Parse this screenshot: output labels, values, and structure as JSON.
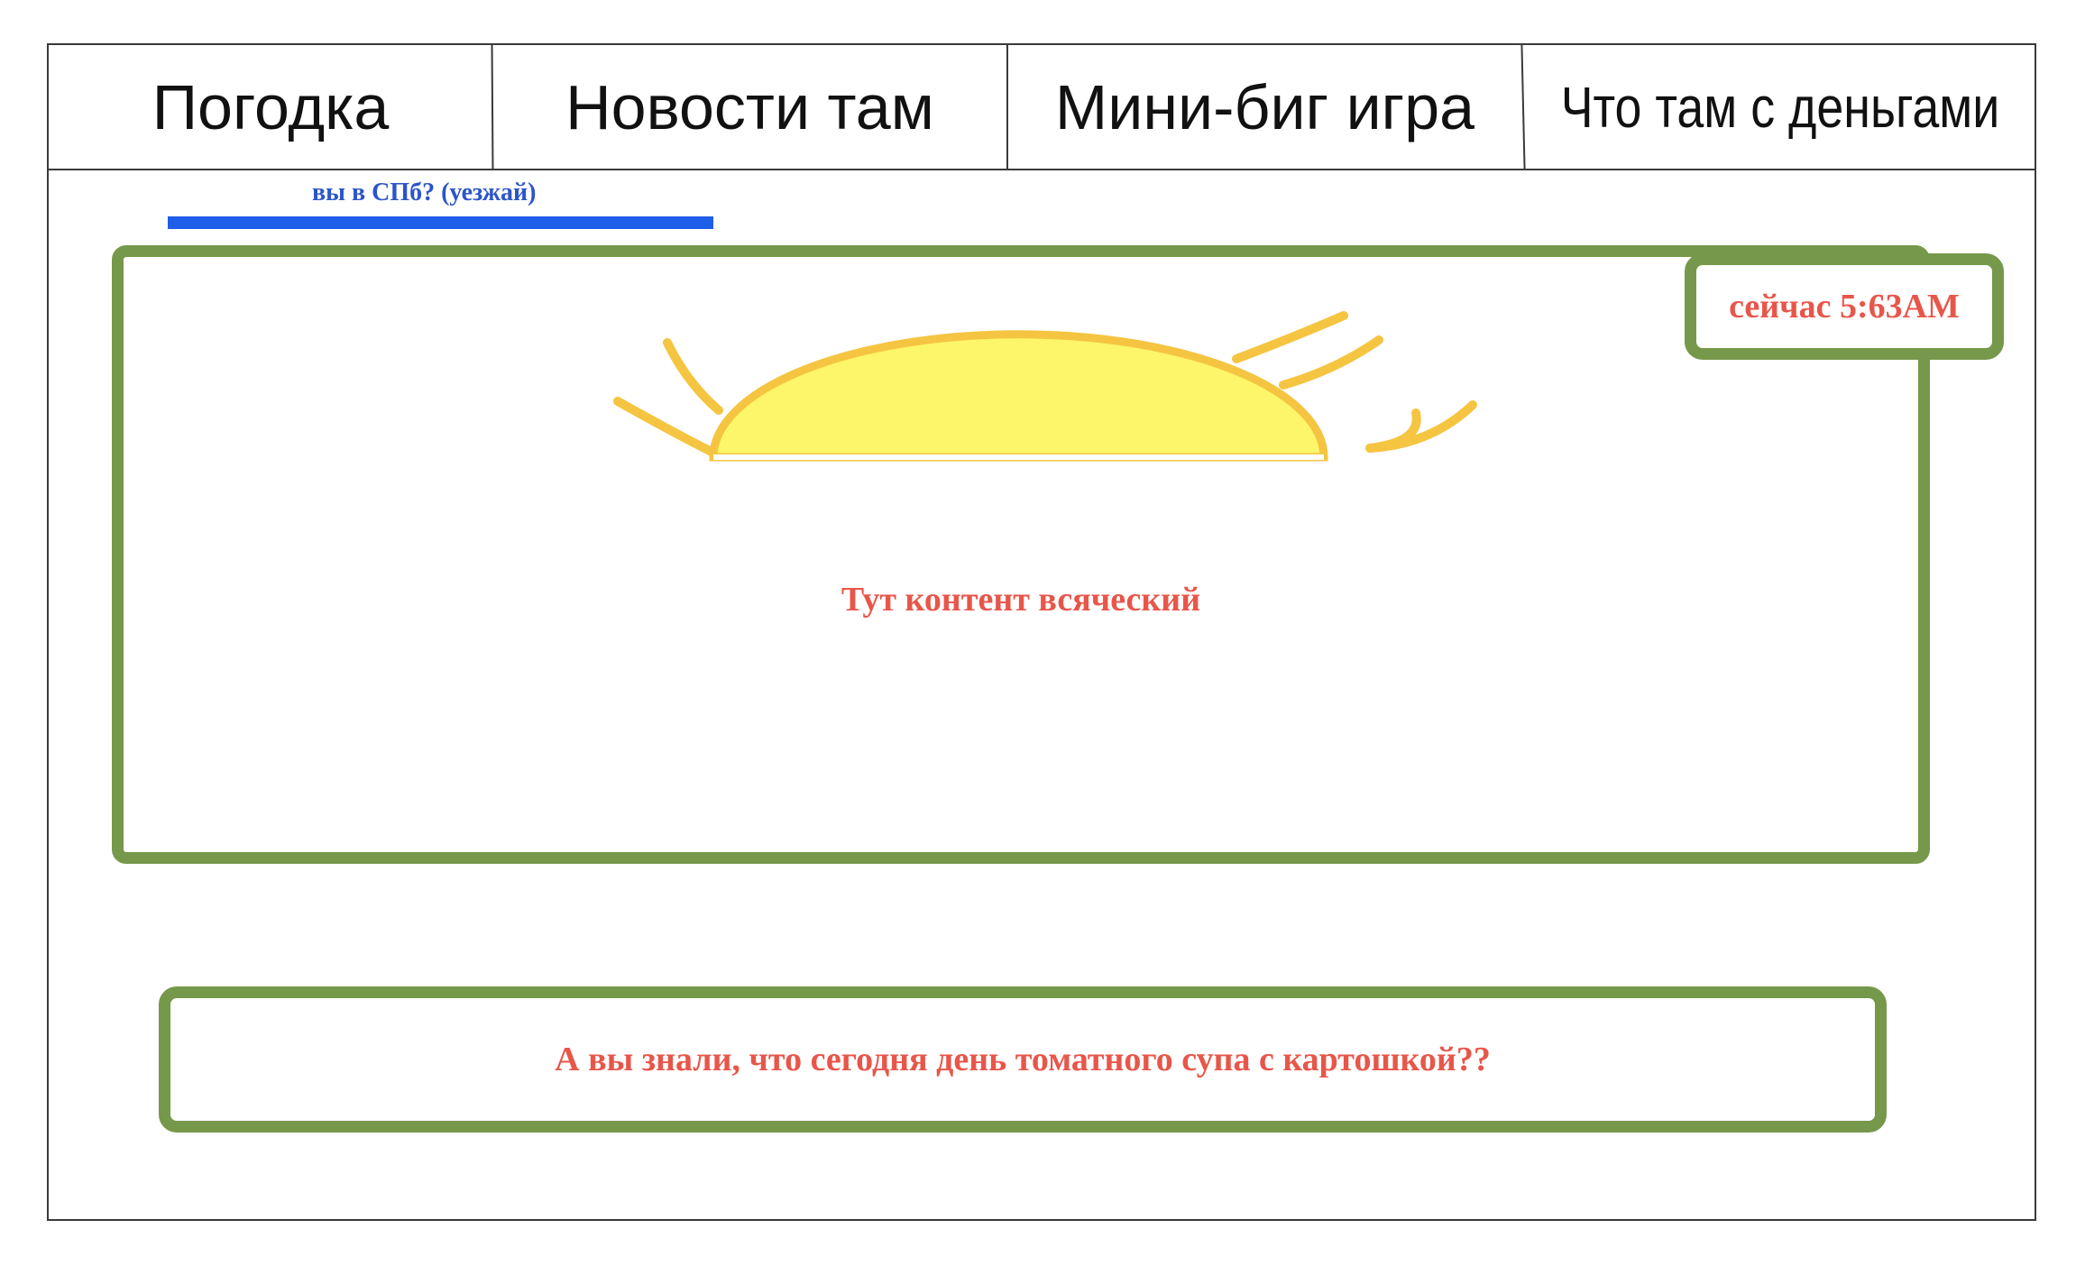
{
  "nav": {
    "tabs": [
      {
        "label": "Погодка"
      },
      {
        "label": "Новости там"
      },
      {
        "label": "Мини-биг игра"
      },
      {
        "label": "Что там с деньгами"
      }
    ]
  },
  "location_prompt": "вы в СПб? (уезжай)",
  "weather": {
    "icon": "sun-icon",
    "time_label": "сейчас 5:63AM",
    "content_placeholder": "Тут контент всяческий"
  },
  "fact": {
    "text": "А вы знали, что сегодня день томатного супа с картошкой??"
  },
  "colors": {
    "panel_border": "#76984a",
    "accent_text": "#e8564a",
    "link": "#2b55c9",
    "link_underline": "#1f5ee8",
    "sun_fill": "#fdf66a",
    "sun_outline": "#f5c542"
  }
}
